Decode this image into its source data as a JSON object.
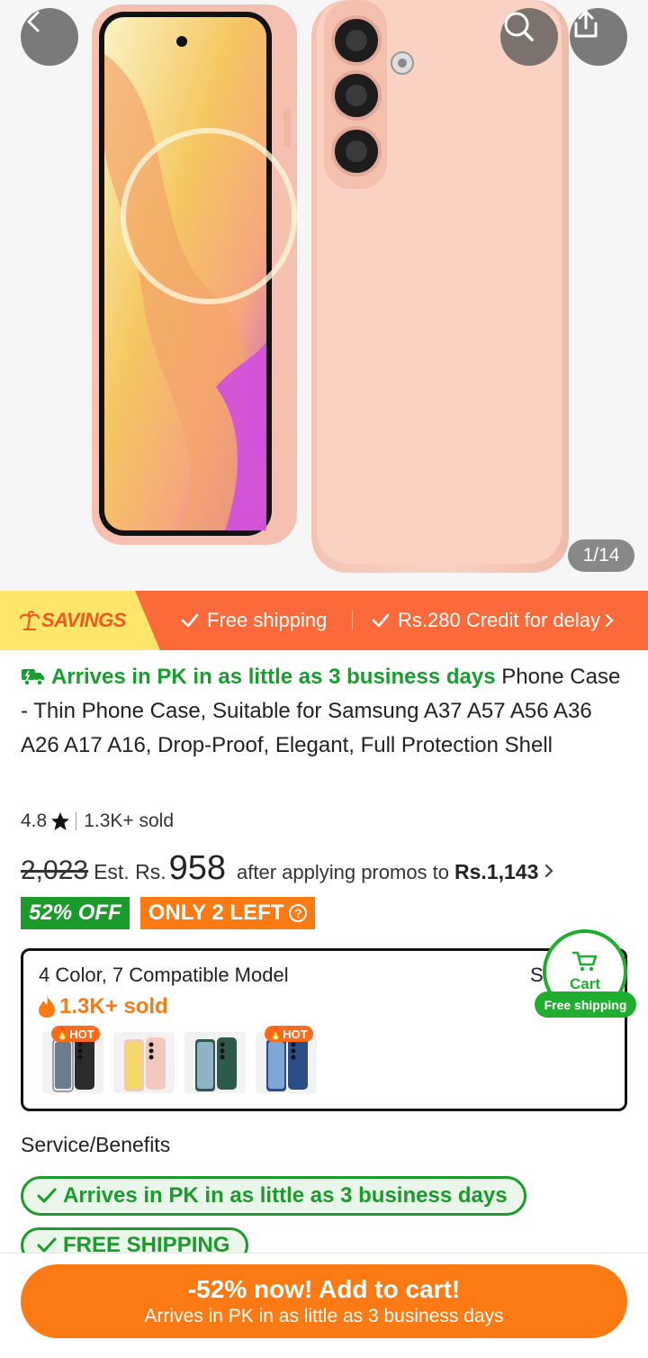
{
  "gallery": {
    "counter": "1/14"
  },
  "savings": {
    "tag": "SAVINGS",
    "free_shipping": "Free shipping",
    "credit": "Rs.280 Credit for delay"
  },
  "product": {
    "arrival": "Arrives in PK in as little as 3 business days",
    "title": "Phone Case - Thin Phone Case, Suitable for Samsung A37 A57 A56 A36 A26 A17 A16, Drop-Proof, Elegant, Full Protection Shell",
    "rating": "4.8",
    "sold": "1.3K+ sold"
  },
  "price": {
    "original": "2,023",
    "est_label": "Est. Rs.",
    "current": "958",
    "after_label": "after applying promos to",
    "promo_price": "Rs.1,143",
    "discount_badge": "52% OFF",
    "stock_badge": "ONLY 2 LEFT"
  },
  "variants": {
    "title": "4 Color, 7 Compatible Model",
    "sold": "1.3K+ sold",
    "size_initial": "S",
    "hot_label": "HOT",
    "colors": [
      "#2c2c2c",
      "#f4c9bd",
      "#2e5a4c",
      "#2a4e85"
    ]
  },
  "cart": {
    "label": "Cart",
    "free_shipping": "Free shipping"
  },
  "services": {
    "title": "Service/Benefits",
    "items": [
      "Arrives in PK in as little as 3 business days",
      "FREE SHIPPING"
    ]
  },
  "cta": {
    "line1": "-52% now! Add to cart!",
    "line2": "Arrives in PK in as little as 3 business days"
  },
  "colors": {
    "brand_orange": "#fb7a14",
    "savings_bar": "#fb6a3b",
    "green": "#1b9b2b",
    "case_pink": "#f7cdbd"
  }
}
